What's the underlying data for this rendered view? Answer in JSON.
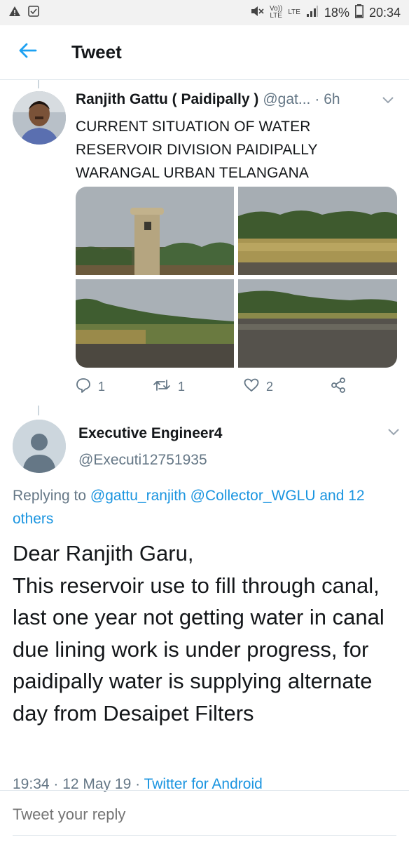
{
  "status_bar": {
    "left_icons": [
      "warning-icon",
      "checkbox-icon"
    ],
    "volte_top": "Vo))",
    "volte_bottom": "LTE",
    "lte_label": "LTE",
    "battery": "18%",
    "time": "20:34"
  },
  "app_bar": {
    "title": "Tweet"
  },
  "tweet1": {
    "name": "Ranjith Gattu ( Paidipally )",
    "handle": "@gat...",
    "time": "· 6h",
    "text": "CURRENT SITUATION OF WATER RESERVOIR DIVISION PAIDIPALLY WARANGAL URBAN TELANGANA",
    "actions": {
      "replies": "1",
      "retweets": "1",
      "likes": "2"
    }
  },
  "tweet2": {
    "name": "Executive Engineer4",
    "handle": "@Executi12751935",
    "replying_prefix": "Replying to",
    "mention1": "@gattu_ranjith",
    "mention2": "@Collector_WGLU",
    "mention3": "and 12 others",
    "text": "Dear Ranjith Garu,\nThis reservoir use to fill through canal, last one year not getting water in canal due lining work is under progress, for paidipally water is supplying alternate day from Desaipet Filters",
    "meta_time": "19:34 · 12 May 19 · ",
    "meta_source": "Twitter for Android"
  },
  "reply": {
    "placeholder": "Tweet your reply"
  },
  "colors": {
    "accent": "#1da1f2",
    "link": "#1b95e0",
    "muted": "#657786",
    "text": "#14171a"
  }
}
